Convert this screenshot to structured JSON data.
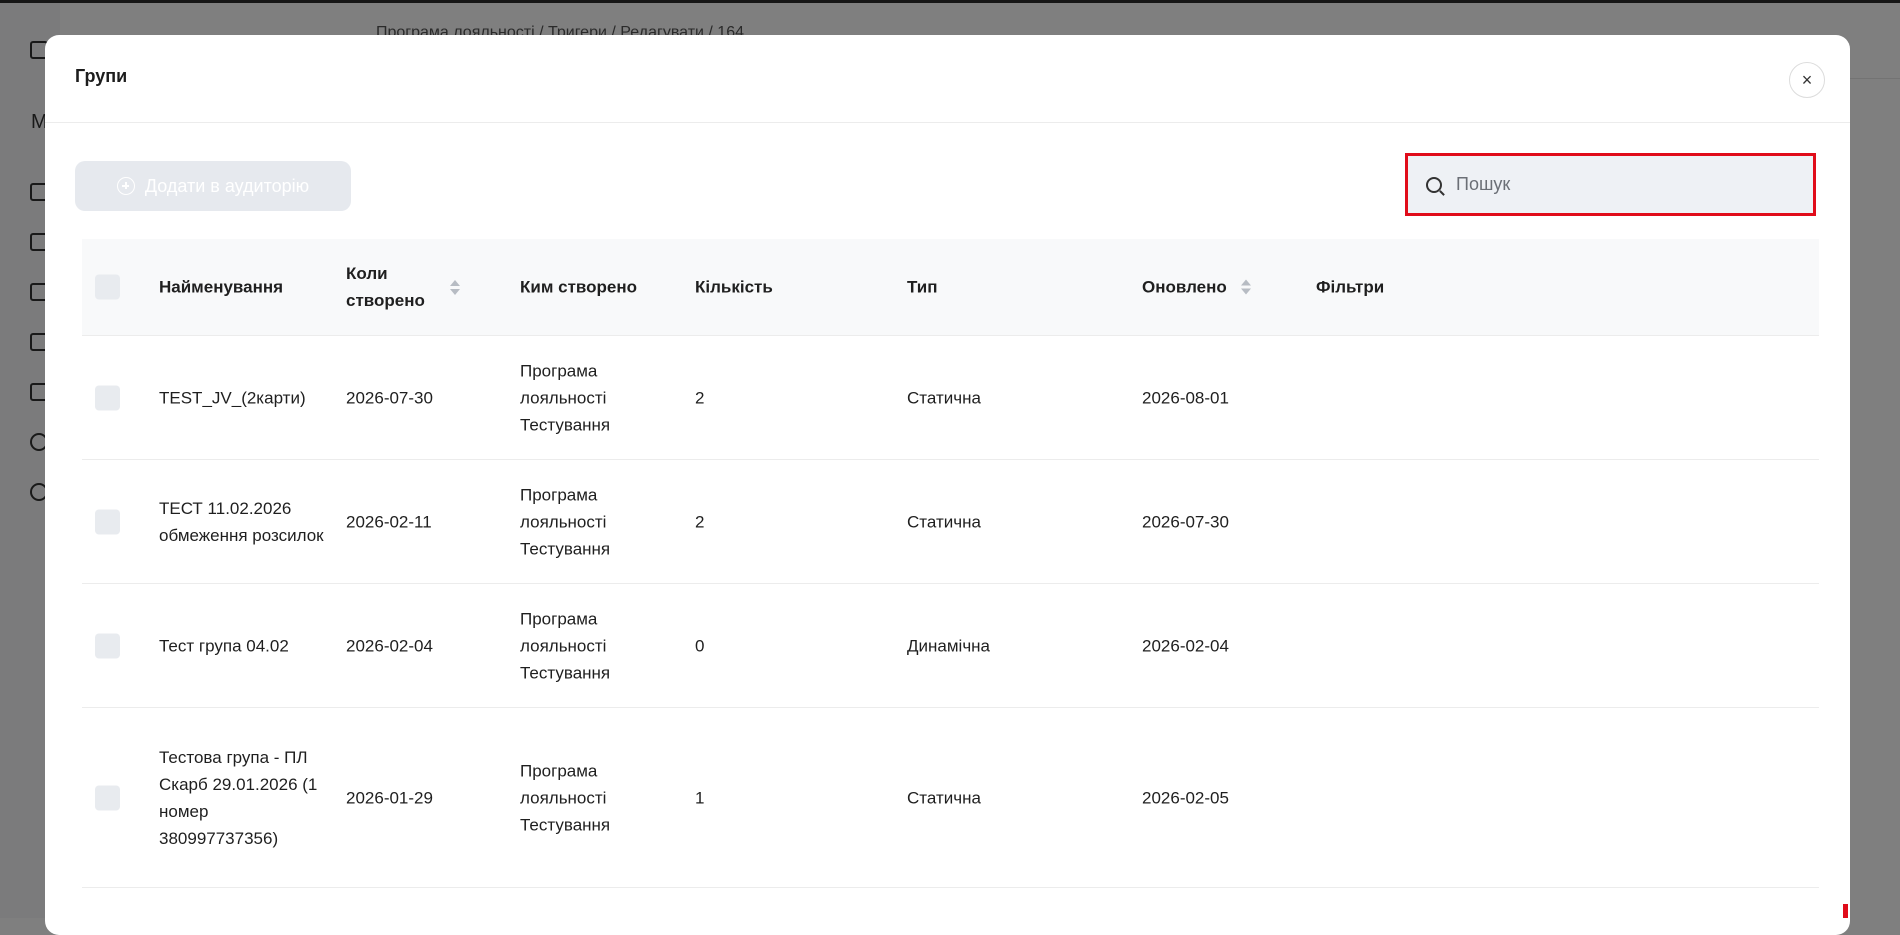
{
  "background": {
    "breadcrumb": "Програма лояльності / Тригери / Редагувати / 164",
    "sidebar_letter": "M"
  },
  "modal": {
    "title": "Групи",
    "close_label": "×",
    "add_button_label": "Додати в аудиторію",
    "search_placeholder": "Пошук"
  },
  "table": {
    "headers": {
      "name": "Найменування",
      "created": "Коли створено",
      "created_by": "Ким створено",
      "count": "Кількість",
      "type": "Тип",
      "updated": "Оновлено",
      "filters": "Фільтри"
    },
    "rows": [
      {
        "name": "TEST_JV_(2карти)",
        "created": "2026-07-30",
        "created_by": "Програма лояльності Тестування",
        "count": "2",
        "type": "Статична",
        "updated": "2026-08-01",
        "filters": ""
      },
      {
        "name": "ТЕСТ 11.02.2026 обмеження розсилок",
        "created": "2026-02-11",
        "created_by": "Програма лояльності Тестування",
        "count": "2",
        "type": "Статична",
        "updated": "2026-07-30",
        "filters": ""
      },
      {
        "name": "Тест група 04.02",
        "created": "2026-02-04",
        "created_by": "Програма лояльності Тестування",
        "count": "0",
        "type": "Динамічна",
        "updated": "2026-02-04",
        "filters": ""
      },
      {
        "name": "Тестова група - ПЛ Скарб 29.01.2026 (1 номер 380997737356)",
        "created": "2026-01-29",
        "created_by": "Програма лояльності Тестування",
        "count": "1",
        "type": "Статична",
        "updated": "2026-02-05",
        "filters": ""
      }
    ]
  },
  "colors": {
    "highlight": "#e00c1a",
    "disabled_button": "#e6e9ee",
    "search_bg": "#eef1f5",
    "header_bg": "#f8f9fa"
  }
}
